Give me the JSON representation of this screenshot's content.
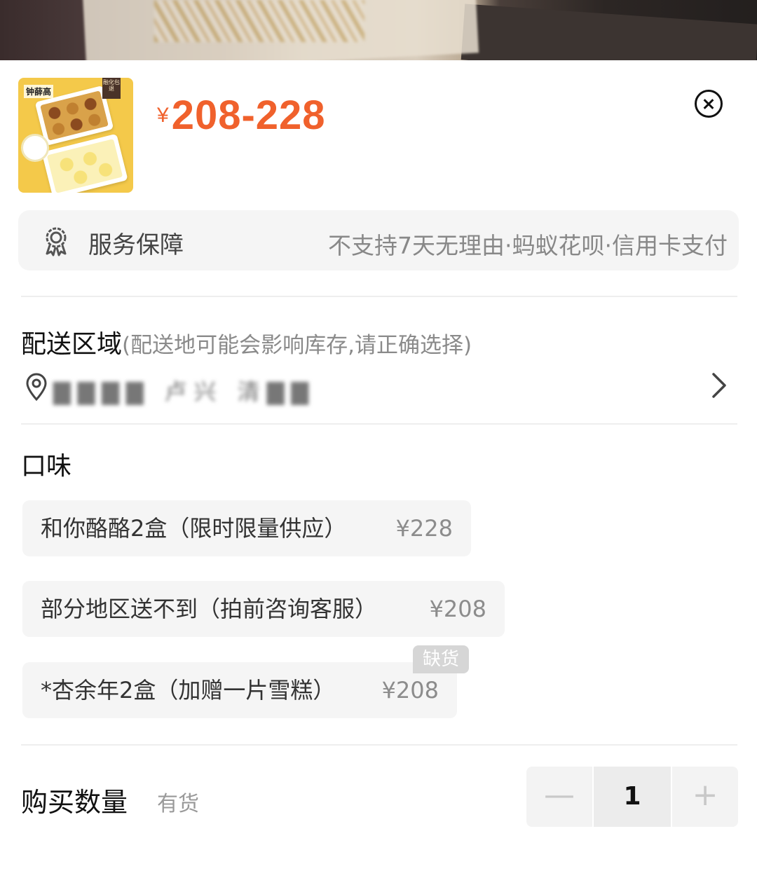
{
  "product": {
    "thumbnail_brand": "钟薛高",
    "thumbnail_tag": "融化包退",
    "price_currency": "¥",
    "price_range": "208-228"
  },
  "service": {
    "label": "服务保障",
    "description": "不支持7天无理由·蚂蚁花呗·信用卡支付"
  },
  "delivery": {
    "title": "配送区域",
    "hint": "(配送地可能会影响库存,请正确选择)",
    "address_obscured": "▇▇▇▇ 卢兴 清▇▇"
  },
  "flavor": {
    "title": "口味",
    "options": [
      {
        "label": "和你酪酪2盒（限时限量供应）",
        "price": "¥228"
      },
      {
        "label": "部分地区送不到（拍前咨询客服）",
        "price": "¥208"
      },
      {
        "label": "*杏余年2盒（加赠一片雪糕）",
        "price": "¥208",
        "badge": "缺货"
      }
    ]
  },
  "quantity": {
    "title": "购买数量",
    "stock": "有货",
    "value": "1",
    "minus": "—",
    "plus": "+"
  }
}
